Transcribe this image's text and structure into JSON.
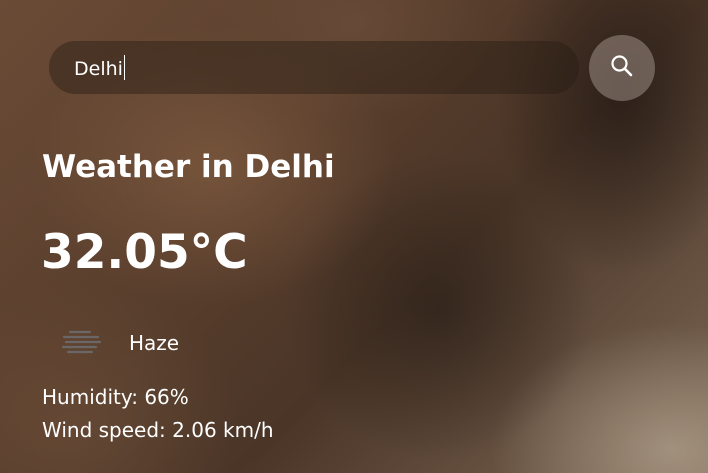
{
  "search": {
    "value": "Delhi",
    "button_icon": "search-icon"
  },
  "weather": {
    "title": "Weather in Delhi",
    "temperature": "32.05°C",
    "condition_icon": "haze-icon",
    "description": "Haze",
    "humidity": "Humidity: 66%",
    "wind": "Wind speed: 2.06 km/h"
  }
}
